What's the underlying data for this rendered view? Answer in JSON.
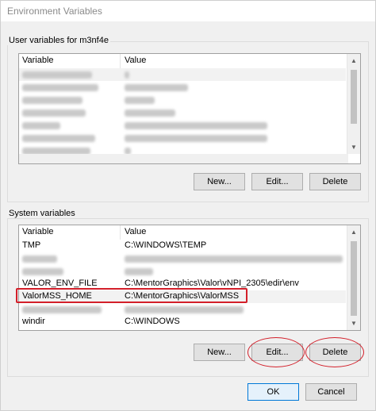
{
  "window": {
    "title": "Environment Variables"
  },
  "user_vars": {
    "group_label": "User variables for m3nf4e",
    "columns": {
      "variable": "Variable",
      "value": "Value"
    },
    "buttons": {
      "new": "New...",
      "edit": "Edit...",
      "delete": "Delete"
    }
  },
  "system_vars": {
    "group_label": "System variables",
    "columns": {
      "variable": "Variable",
      "value": "Value"
    },
    "rows": [
      {
        "variable": "TMP",
        "value": "C:\\WINDOWS\\TEMP"
      },
      {
        "variable": "VALOR_ENV_FILE",
        "value": "C:\\MentorGraphics\\Valor\\vNPI_2305\\edir\\env"
      },
      {
        "variable": "ValorMSS_HOME",
        "value": "C:\\MentorGraphics\\ValorMSS"
      },
      {
        "variable": "windir",
        "value": "C:\\WINDOWS"
      }
    ],
    "buttons": {
      "new": "New...",
      "edit": "Edit...",
      "delete": "Delete"
    }
  },
  "dialog_buttons": {
    "ok": "OK",
    "cancel": "Cancel"
  },
  "colors": {
    "highlight": "#d31f2a",
    "accent": "#0078d7"
  }
}
